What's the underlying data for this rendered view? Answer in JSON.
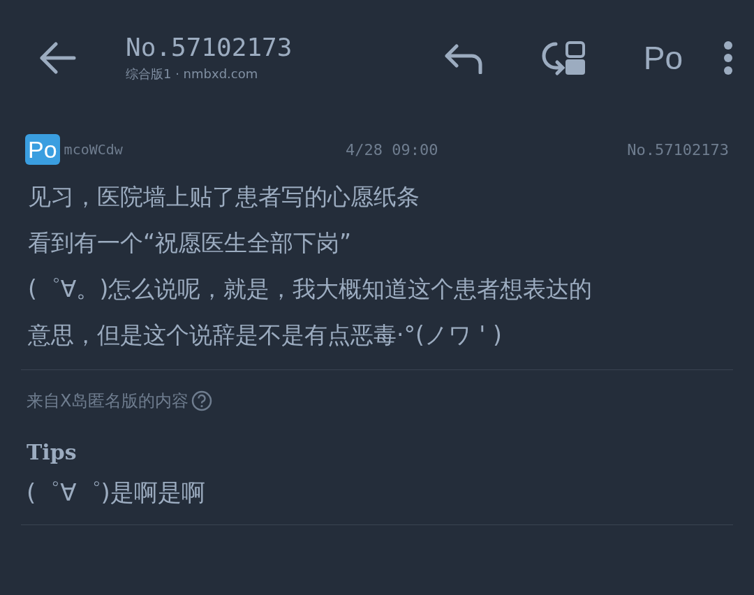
{
  "toolbar": {
    "title": "No.57102173",
    "subtitle": "综合版1 · nmbxd.com",
    "po_button": "Po"
  },
  "post": {
    "badge": "Po",
    "user": "mcoWCdw",
    "time": "4/28 09:00",
    "number": "No.57102173",
    "lines": [
      "见习，医院墙上贴了患者写的心愿纸条",
      "看到有一个“祝愿医生全部下岗”",
      "(゜∀。)怎么说呢，就是，我大概知道这个患者想表达的",
      "意思，但是这个说辞是不是有点恶毒·°(ノワ ' )"
    ]
  },
  "source_note": "来自X岛匿名版的内容",
  "tips": {
    "title": "Tips",
    "text": "(゜∀゜)是啊是啊"
  }
}
